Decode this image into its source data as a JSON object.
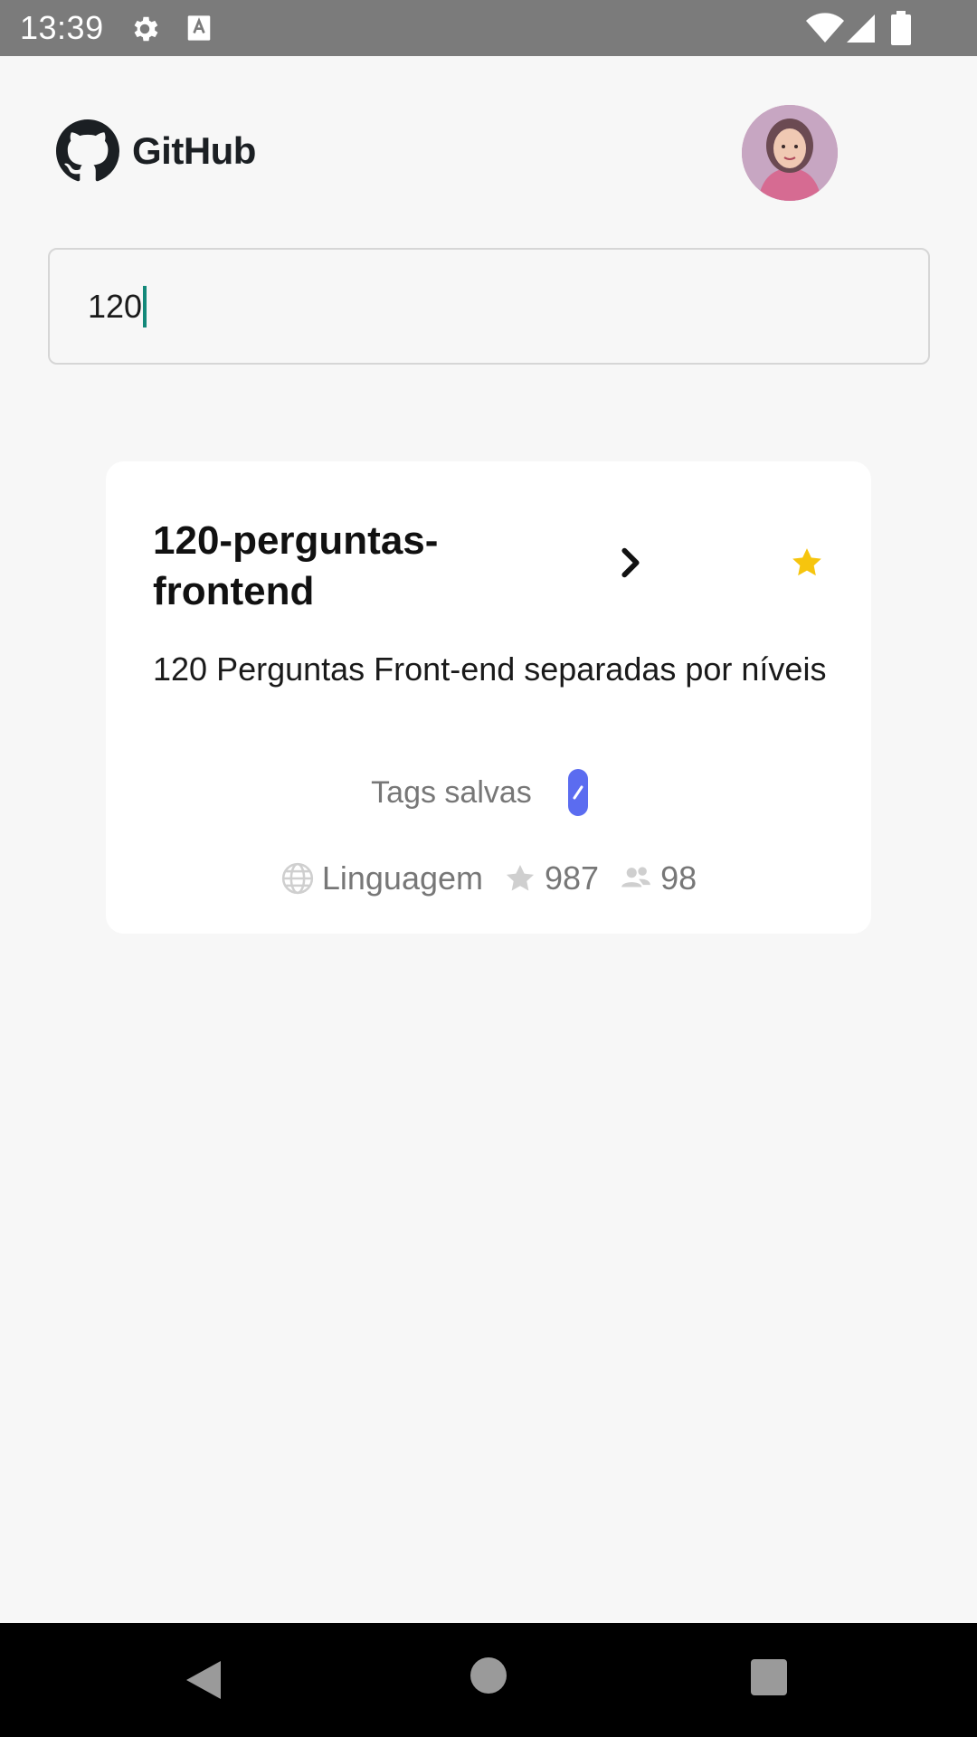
{
  "status_bar": {
    "time": "13:39",
    "icons": [
      "gear-icon",
      "a-keyboard-icon",
      "wifi-icon",
      "signal-icon",
      "battery-icon"
    ]
  },
  "header": {
    "logo_text": "GitHub",
    "logo_icon": "github-octocat-icon",
    "avatar": "user-avatar"
  },
  "search": {
    "value": "120"
  },
  "results": [
    {
      "title": "120-perguntas-frontend",
      "description": "120 Perguntas Front-end separadas por níveis",
      "tags_label": "Tags salvas",
      "language_label": "Linguagem",
      "stars": "987",
      "forks": "98",
      "starred": true
    }
  ],
  "colors": {
    "status_bar": "#7b7b7b",
    "background": "#f7f7f7",
    "card": "#ffffff",
    "caret": "#13897a",
    "star": "#f6c50e",
    "tag_edit": "#5b6cf0",
    "nav_bar": "#000000"
  }
}
